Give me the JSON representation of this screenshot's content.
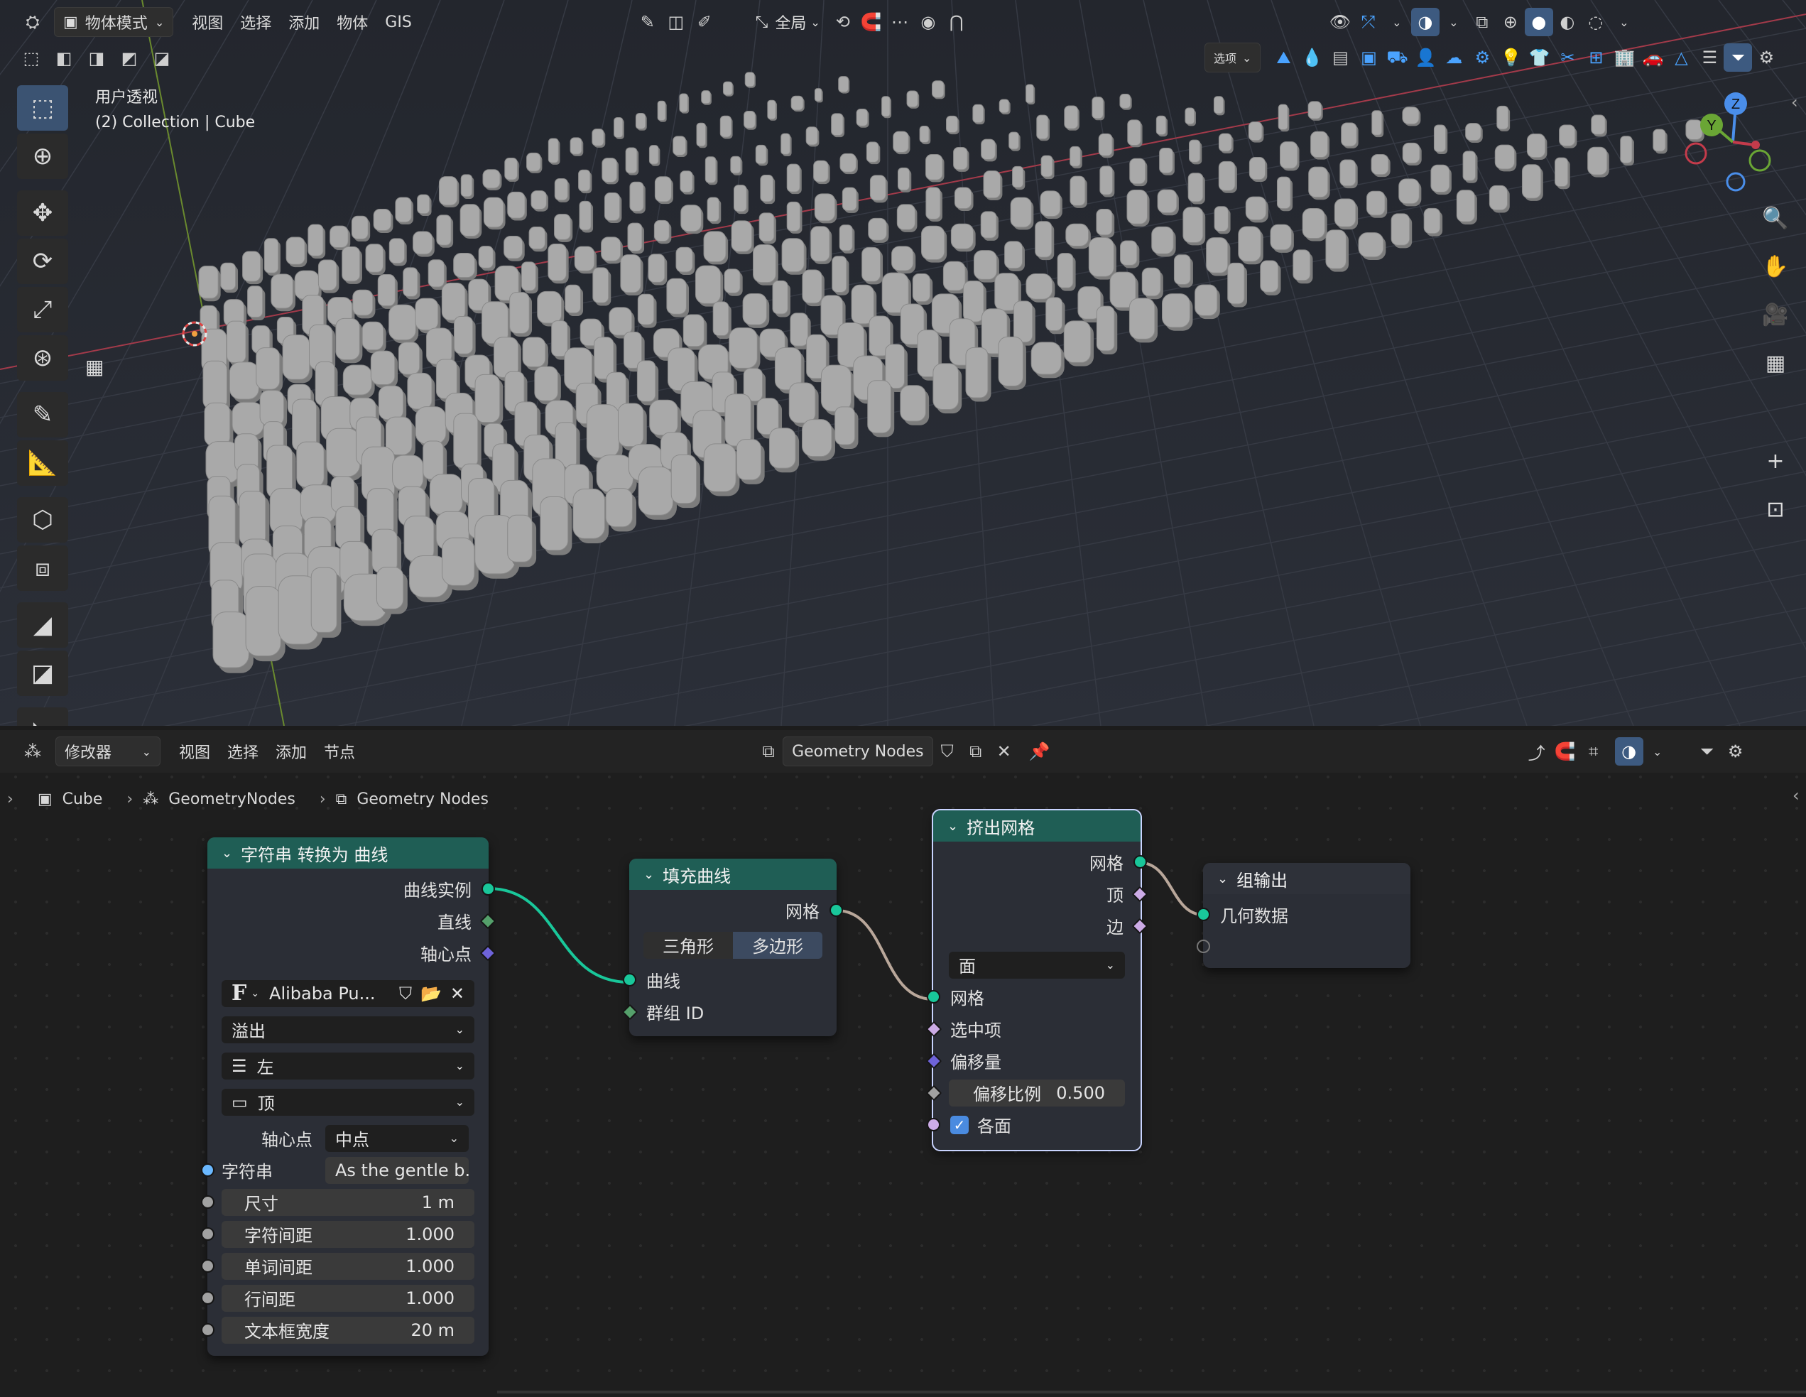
{
  "viewport": {
    "header": {
      "mode": "物体模式",
      "menus": [
        "视图",
        "选择",
        "添加",
        "物体",
        "GIS"
      ],
      "orientation": "全局",
      "options": "选项"
    },
    "info_line1": "用户透视",
    "info_line2": "(2) Collection | Cube",
    "gizmo": {
      "z": "Z",
      "y": "Y"
    }
  },
  "node_editor": {
    "header": {
      "type": "修改器",
      "menus": [
        "视图",
        "选择",
        "添加",
        "节点"
      ],
      "tree_name": "Geometry Nodes"
    },
    "breadcrumb": [
      "Cube",
      "GeometryNodes",
      "Geometry Nodes"
    ],
    "nodes": {
      "string_to_curves": {
        "title": "字符串 转换为 曲线",
        "out_instances": "曲线实例",
        "out_line": "直线",
        "out_pivot": "轴心点",
        "font": "Alibaba Pu...",
        "overflow": "溢出",
        "align_x": "左",
        "align_y": "顶",
        "pivot_label": "轴心点",
        "pivot_value": "中点",
        "string_label": "字符串",
        "string_value": "As the gentle b...",
        "size_label": "尺寸",
        "size_value": "1 m",
        "char_spacing_label": "字符间距",
        "char_spacing_value": "1.000",
        "word_spacing_label": "单词间距",
        "word_spacing_value": "1.000",
        "line_spacing_label": "行间距",
        "line_spacing_value": "1.000",
        "text_box_width_label": "文本框宽度",
        "text_box_width_value": "20 m"
      },
      "fill_curve": {
        "title": "填充曲线",
        "out_mesh": "网格",
        "mode_triangle": "三角形",
        "mode_ngon": "多边形",
        "in_curve": "曲线",
        "in_group_id": "群组 ID"
      },
      "extrude_mesh": {
        "title": "挤出网格",
        "out_mesh": "网格",
        "out_top": "顶",
        "out_side": "边",
        "mode": "面",
        "in_mesh": "网格",
        "in_selection": "选中项",
        "in_offset": "偏移量",
        "offset_scale_label": "偏移比例",
        "offset_scale_value": "0.500",
        "individual_label": "各面"
      },
      "group_output": {
        "title": "组输出",
        "in_geometry": "几何数据"
      }
    }
  }
}
